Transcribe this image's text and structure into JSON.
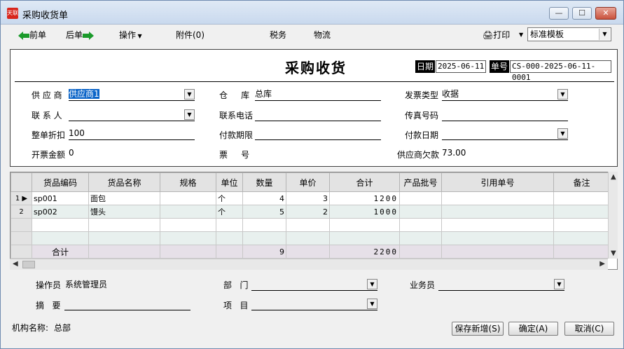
{
  "window": {
    "title": "采购收货单",
    "app_badge": "天联"
  },
  "toolbar": {
    "prev_label": "前单",
    "next_label": "后单",
    "operate_label": "操作",
    "attach_label": "附件(0)",
    "tax_label": "税务",
    "logistics_label": "物流",
    "print_label": "打印",
    "template_value": "标准模板"
  },
  "form": {
    "title": "采购收货",
    "date_label": "日期",
    "date_value": "2025-06-11",
    "no_label": "单号",
    "no_value": "CS-000-2025-06-11-0001",
    "supplier_label": "供 应 商",
    "supplier_value": "供应商1",
    "warehouse_label": "仓     库",
    "warehouse_value": "总库",
    "invoice_type_label": "发票类型",
    "invoice_type_value": "收据",
    "contact_label": "联 系 人",
    "contact_value": "",
    "phone_label": "联系电话",
    "phone_value": "",
    "fax_label": "传真号码",
    "fax_value": "",
    "discount_label": "整单折扣",
    "discount_value": "100",
    "pay_term_label": "付款期限",
    "pay_term_value": "",
    "pay_date_label": "付款日期",
    "pay_date_value": "",
    "invoice_amount_label": "开票金额",
    "invoice_amount_value": "0",
    "ticket_no_label": "票     号",
    "ticket_no_value": "",
    "supplier_debt_label": "供应商欠款",
    "supplier_debt_value": "73.00"
  },
  "grid": {
    "columns": [
      "货品编码",
      "货品名称",
      "规格",
      "单位",
      "数量",
      "单价",
      "合计",
      "产品批号",
      "引用单号",
      "备注"
    ],
    "rows": [
      {
        "index": "1",
        "code": "sp001",
        "name": "面包",
        "spec": "",
        "unit": "个",
        "qty": "4",
        "price": "3",
        "total": "1200"
      },
      {
        "index": "2",
        "code": "sp002",
        "name": "馒头",
        "spec": "",
        "unit": "个",
        "qty": "5",
        "price": "2",
        "total": "1000"
      }
    ],
    "total_row": {
      "label": "合计",
      "qty": "9",
      "total": "2200"
    }
  },
  "footer": {
    "operator_label": "操作员",
    "operator_value": "系统管理员",
    "dept_label": "部   门",
    "dept_value": "",
    "salesman_label": "业务员",
    "salesman_value": "",
    "summary_label": "摘   要",
    "summary_value": "",
    "project_label": "项   目",
    "project_value": "",
    "org_label": "机构名称:",
    "org_value": "总部",
    "save_new_label": "保存新增(S)",
    "ok_label": "确定(A)",
    "cancel_label": "取消(C)"
  },
  "colors": {
    "accent": "#0a64c8",
    "close_red": "#c9523d",
    "amount_line": "#d00000"
  }
}
